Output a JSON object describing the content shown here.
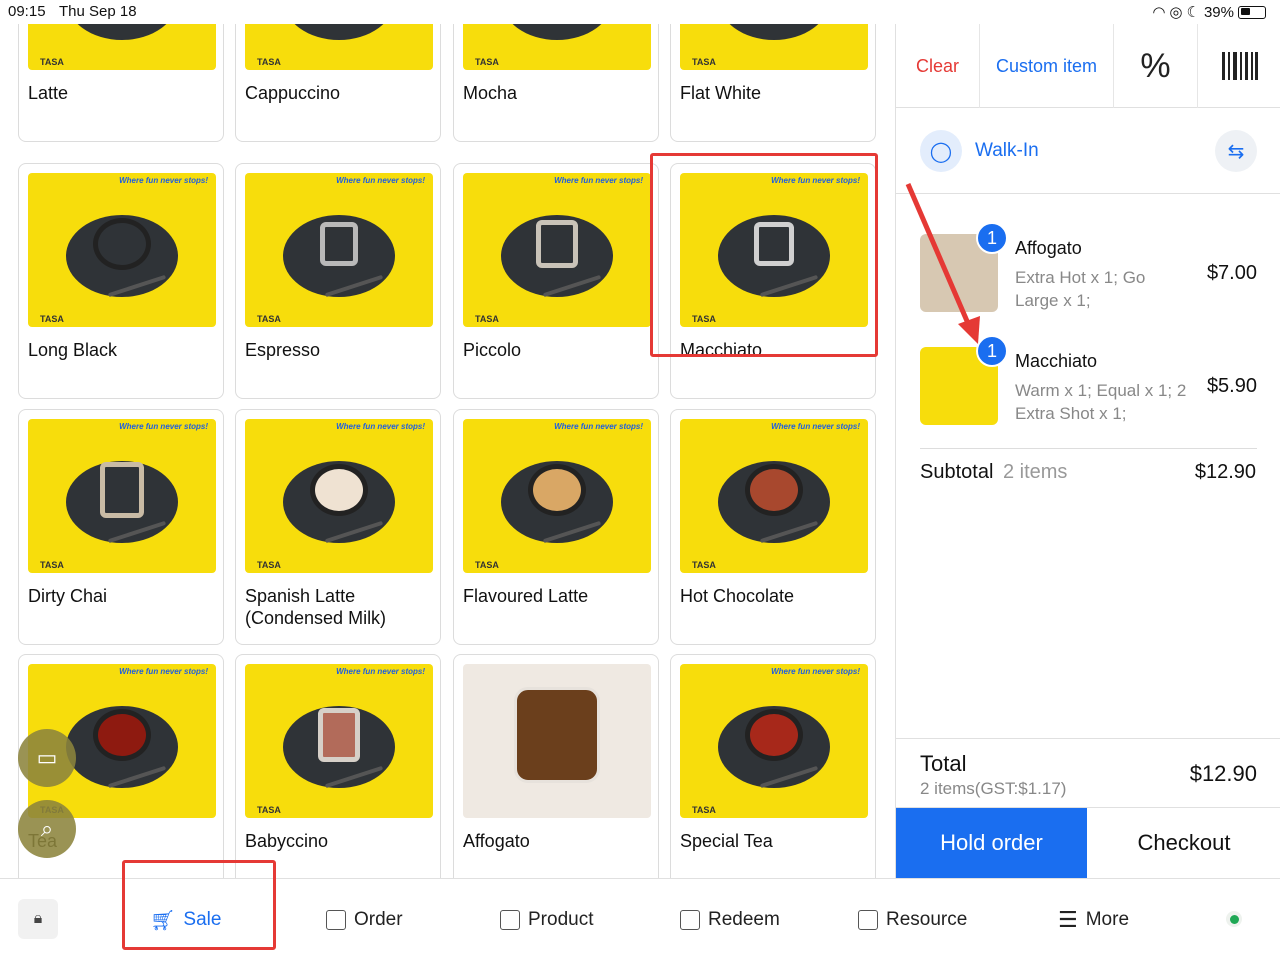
{
  "status_bar": {
    "time": "09:15",
    "date": "Thu Sep 18",
    "battery": "39%"
  },
  "products": [
    {
      "name": "Latte"
    },
    {
      "name": "Cappuccino"
    },
    {
      "name": "Mocha"
    },
    {
      "name": "Flat White"
    },
    {
      "name": "Long Black"
    },
    {
      "name": "Espresso"
    },
    {
      "name": "Piccolo"
    },
    {
      "name": "Macchiato"
    },
    {
      "name": "Dirty Chai"
    },
    {
      "name": "Spanish Latte (Condensed Milk)"
    },
    {
      "name": "Flavoured Latte"
    },
    {
      "name": "Hot Chocolate"
    },
    {
      "name": "Tea"
    },
    {
      "name": "Babyccino"
    },
    {
      "name": "Affogato"
    },
    {
      "name": "Special Tea"
    }
  ],
  "thumb": {
    "slogan": "Where fun never stops!",
    "brand": "TASA"
  },
  "panel": {
    "clear_label": "Clear",
    "custom_item_label": "Custom item",
    "discount_icon": "%",
    "customer_name": "Walk-In",
    "items": [
      {
        "qty": "1",
        "name": "Affogato",
        "mods": "Extra Hot x 1; Go Large x 1;",
        "price": "$7.00"
      },
      {
        "qty": "1",
        "name": "Macchiato",
        "mods": "Warm x 1; Equal x 1; 2 Extra Shot x 1;",
        "price": "$5.90"
      }
    ],
    "subtotal_label": "Subtotal",
    "subtotal_count": "2 items",
    "subtotal_value": "$12.90",
    "total_label": "Total",
    "total_sub": "2 items(GST:$1.17)",
    "total_value": "$12.90",
    "hold_label": "Hold order",
    "checkout_label": "Checkout"
  },
  "nav": [
    {
      "label": "Sale"
    },
    {
      "label": "Order"
    },
    {
      "label": "Product"
    },
    {
      "label": "Redeem"
    },
    {
      "label": "Resource"
    },
    {
      "label": "More"
    }
  ],
  "colors": {
    "accent": "#1a6ef0",
    "danger": "#e53935",
    "tile": "#f7dd0c"
  }
}
